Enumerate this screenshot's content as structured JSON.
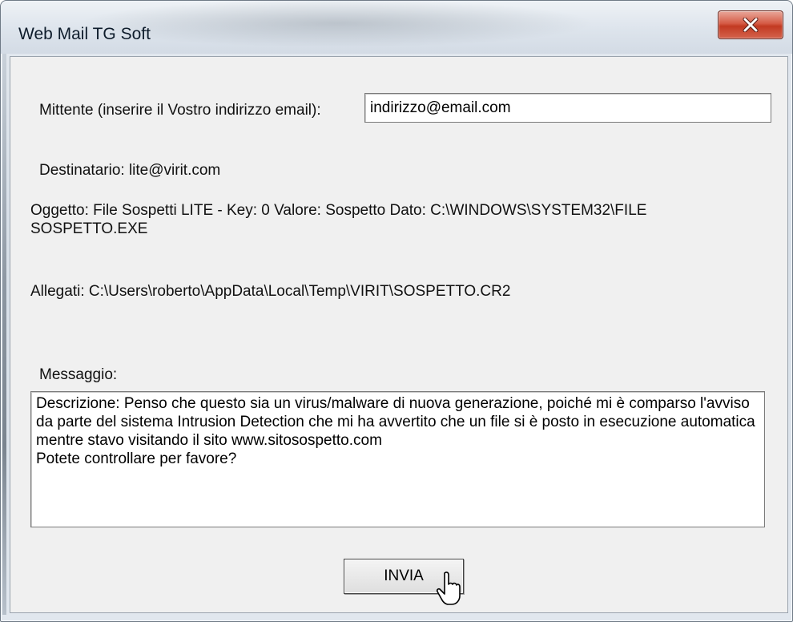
{
  "window": {
    "title": "Web Mail TG Soft",
    "close_icon": "close-icon",
    "close_color": "#c9442c"
  },
  "form": {
    "sender_label": "Mittente (inserire il Vostro indirizzo email):",
    "sender_value": "indirizzo@email.com",
    "recipient_text": "Destinatario:  lite@virit.com",
    "subject_line1": "Oggetto: File Sospetti LITE - Key: 0 Valore: Sospetto Dato: C:\\WINDOWS\\SYSTEM32\\FILE",
    "subject_line2": "SOSPETTO.EXE",
    "attachments_text": "Allegati: C:\\Users\\roberto\\AppData\\Local\\Temp\\VIRIT\\SOSPETTO.CR2",
    "message_label": "Messaggio:",
    "message_value": "Descrizione: Penso che questo sia un virus/malware di nuova generazione, poiché mi è comparso l'avviso da parte del sistema Intrusion Detection che mi ha avvertito che un file si è posto in esecuzione automatica mentre stavo visitando il sito www.sitosospetto.com\nPotete controllare per favore?",
    "send_label": "INVIA"
  },
  "cursor_icon": "mouse-pointer-icon"
}
